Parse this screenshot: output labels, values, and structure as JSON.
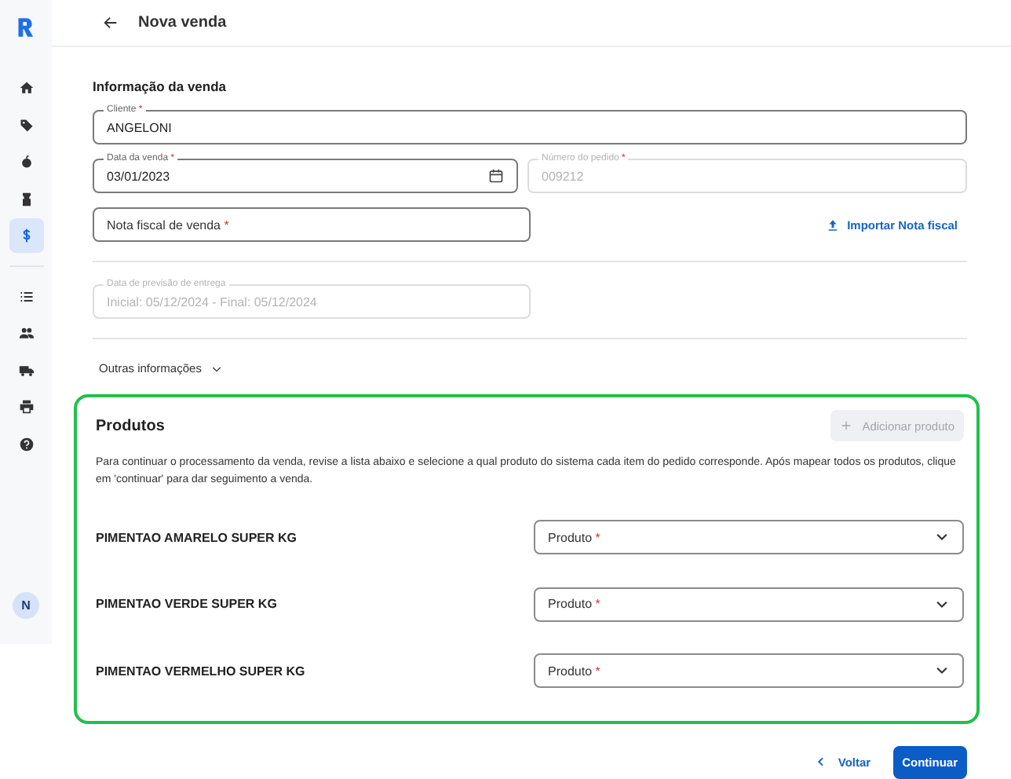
{
  "header": {
    "title": "Nova venda"
  },
  "sidebar": {
    "groups": [
      [
        {
          "kind": "home",
          "selected": false
        },
        {
          "kind": "tag",
          "selected": false
        },
        {
          "kind": "fruit",
          "selected": false
        },
        {
          "kind": "bottle",
          "selected": false
        },
        {
          "kind": "dollar",
          "selected": true
        }
      ],
      [
        {
          "kind": "list",
          "selected": false
        },
        {
          "kind": "people",
          "selected": false
        },
        {
          "kind": "truck",
          "selected": false
        },
        {
          "kind": "printer",
          "selected": false
        },
        {
          "kind": "help",
          "selected": false
        }
      ]
    ],
    "avatar": "N"
  },
  "sale_info": {
    "title": "Informação da venda",
    "client": {
      "label": "Cliente",
      "required_mark": "*",
      "value": "ANGELONI",
      "disabled": false
    },
    "sale_date": {
      "label": "Data da venda",
      "required_mark": "*",
      "value": "03/01/2023",
      "disabled": false
    },
    "order_number": {
      "label": "Número do pedido",
      "required_mark": "*",
      "value": "009212",
      "disabled": true
    },
    "invoice": {
      "placeholder": "Nota fiscal de venda",
      "required_mark": "*",
      "disabled": false
    },
    "import_link": "Importar Nota fiscal",
    "delivery": {
      "label": "Data de previsão de entrega",
      "value": "Inicial: 05/12/2024 - Final: 05/12/2024",
      "disabled": true
    },
    "more_info": {
      "label": "Outras informações",
      "expanded": false
    }
  },
  "products": {
    "title": "Produtos",
    "highlighted": true,
    "add_button": {
      "label": "Adicionar produto",
      "disabled": true
    },
    "description": "Para continuar o processamento da venda, revise a lista abaixo e selecione a qual produto do sistema cada item do pedido corresponde. Após mapear todos os produtos, clique em 'continuar' para dar seguimento a venda.",
    "items": [
      {
        "name": "PIMENTAO AMARELO SUPER KG",
        "select": {
          "placeholder": "Produto",
          "required_mark": "*"
        }
      },
      {
        "name": "PIMENTAO VERDE SUPER KG",
        "select": {
          "placeholder": "Produto",
          "required_mark": "*"
        }
      },
      {
        "name": "PIMENTAO VERMELHO SUPER KG",
        "select": {
          "placeholder": "Produto",
          "required_mark": "*"
        }
      }
    ]
  },
  "footer": {
    "back": "Voltar",
    "continue": "Continuar"
  }
}
